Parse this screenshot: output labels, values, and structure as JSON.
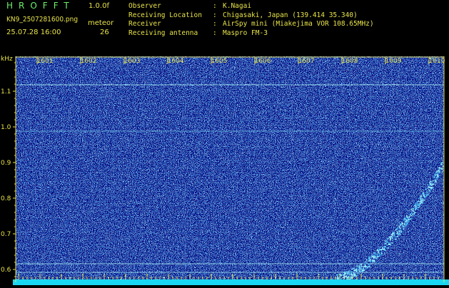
{
  "header": {
    "app_title": "HROFFT",
    "version": "1.0.0f",
    "filename": "KN9_2507281600.png",
    "meteor_label": "meteor",
    "datetime": "25.07.28 16:00",
    "meteor_count": "26",
    "info": [
      {
        "key": "Observer",
        "value": "K.Nagai"
      },
      {
        "key": "Receiving Location",
        "value": "Chigasaki, Japan (139.414 35.340)"
      },
      {
        "key": "Receiver",
        "value": "AirSpy mini (Miakejima VOR 108.65MHz)"
      },
      {
        "key": "Receiving antenna",
        "value": "Maspro FM-3"
      }
    ]
  },
  "spectrogram": {
    "y_unit": "kHz",
    "y_ticks": [
      "1.1",
      "1.0",
      "0.9",
      "0.8",
      "0.7",
      "0.6"
    ],
    "x_ticks": [
      "1601",
      "1602",
      "1603",
      "1604",
      "1605",
      "1606",
      "1607",
      "1608",
      "1609",
      "1610"
    ],
    "colors": {
      "background": "#00007a",
      "axis": "#e8e34a",
      "bottom_band": "#19d7f2",
      "carrier_line": "#a6f0f5"
    }
  }
}
